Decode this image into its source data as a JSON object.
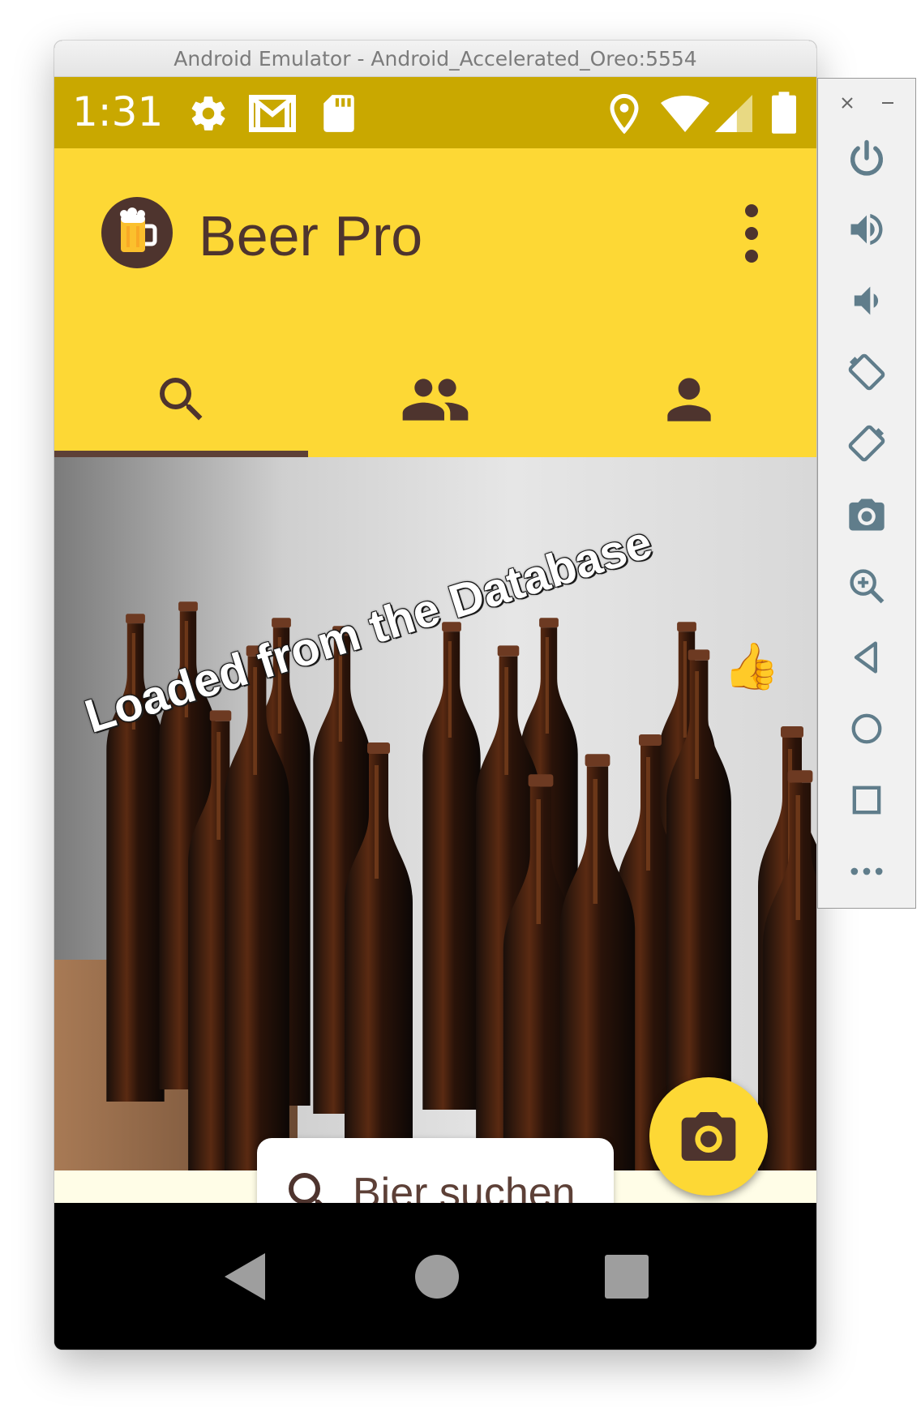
{
  "window": {
    "title": "Android Emulator - Android_Accelerated_Oreo:5554"
  },
  "status_bar": {
    "time": "1:31",
    "left_icons": [
      "settings-icon",
      "gmail-icon",
      "sd-card-icon"
    ],
    "right_icons": [
      "location-icon",
      "wifi-icon",
      "signal-icon",
      "battery-icon"
    ]
  },
  "app_bar": {
    "title": "Beer Pro",
    "logo_icon": "beer-mug-icon",
    "menu_icon": "more-vert-icon"
  },
  "tabs": [
    {
      "icon": "search-icon",
      "selected": true
    },
    {
      "icon": "people-icon",
      "selected": false
    },
    {
      "icon": "person-icon",
      "selected": false
    }
  ],
  "hero": {
    "caption": "Loaded from the Database",
    "emoji": "👍"
  },
  "search": {
    "placeholder": "Bier suchen"
  },
  "fab": {
    "icon": "camera-icon"
  },
  "nav_bar": [
    "back-icon",
    "home-icon",
    "recents-icon"
  ],
  "side_panel": [
    "close-icon",
    "minimize-icon",
    "power-icon",
    "volume-up-icon",
    "volume-down-icon",
    "rotate-left-icon",
    "rotate-right-icon",
    "screenshot-icon",
    "zoom-icon",
    "back-icon",
    "home-icon",
    "overview-icon",
    "more-icon"
  ],
  "colors": {
    "status_bar": "#c9a800",
    "app_bar": "#fdd835",
    "brown": "#4e342e",
    "cream": "#fffde7"
  }
}
